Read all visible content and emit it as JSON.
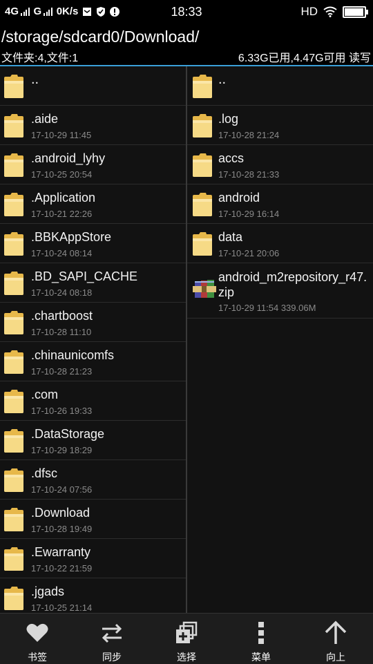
{
  "status_bar": {
    "network": "4G",
    "carrier_mark": "G",
    "speed": "0K/s",
    "time": "18:33",
    "hd": "HD",
    "icons": [
      "signal-icon",
      "mail-icon",
      "shield-icon",
      "alert-icon",
      "wifi-icon",
      "battery-icon"
    ],
    "battery_level": 0.9
  },
  "header": {
    "path": "/storage/sdcard0/Download/",
    "counts": "文件夹:4,文件:1",
    "storage": "6.33G已用,4.47G可用 读写"
  },
  "left_pane": {
    "items": [
      {
        "name": "..",
        "date": ""
      },
      {
        "name": ".aide",
        "date": "17-10-29 11:45"
      },
      {
        "name": ".android_lyhy",
        "date": "17-10-25 20:54"
      },
      {
        "name": ".Application",
        "date": "17-10-21 22:26"
      },
      {
        "name": ".BBKAppStore",
        "date": "17-10-24 08:14"
      },
      {
        "name": ".BD_SAPI_CACHE",
        "date": "17-10-24 08:18"
      },
      {
        "name": ".chartboost",
        "date": "17-10-28 11:10"
      },
      {
        "name": ".chinaunicomfs",
        "date": "17-10-28 21:23"
      },
      {
        "name": ".com",
        "date": "17-10-26 19:33"
      },
      {
        "name": ".DataStorage",
        "date": "17-10-29 18:29"
      },
      {
        "name": ".dfsc",
        "date": "17-10-24 07:56"
      },
      {
        "name": ".Download",
        "date": "17-10-28 19:49"
      },
      {
        "name": ".Ewarranty",
        "date": "17-10-22 21:59"
      },
      {
        "name": ".jgads",
        "date": "17-10-25 21:14"
      }
    ]
  },
  "right_pane": {
    "items": [
      {
        "name": "..",
        "date": "",
        "type": "folder"
      },
      {
        "name": ".log",
        "date": "17-10-28 21:24",
        "type": "folder"
      },
      {
        "name": "accs",
        "date": "17-10-28 21:33",
        "type": "folder"
      },
      {
        "name": "android",
        "date": "17-10-29 16:14",
        "type": "folder"
      },
      {
        "name": "data",
        "date": "17-10-21 20:06",
        "type": "folder"
      },
      {
        "name": "android_m2repository_r47.zip",
        "date": "17-10-29 11:54  339.06M",
        "type": "archive"
      }
    ]
  },
  "toolbar": {
    "bookmarks": "书签",
    "sync": "同步",
    "select": "选择",
    "menu": "菜单",
    "up": "向上"
  },
  "colors": {
    "accent": "#3a9fd8",
    "folder": "#f3d27a",
    "background": "#121212"
  }
}
